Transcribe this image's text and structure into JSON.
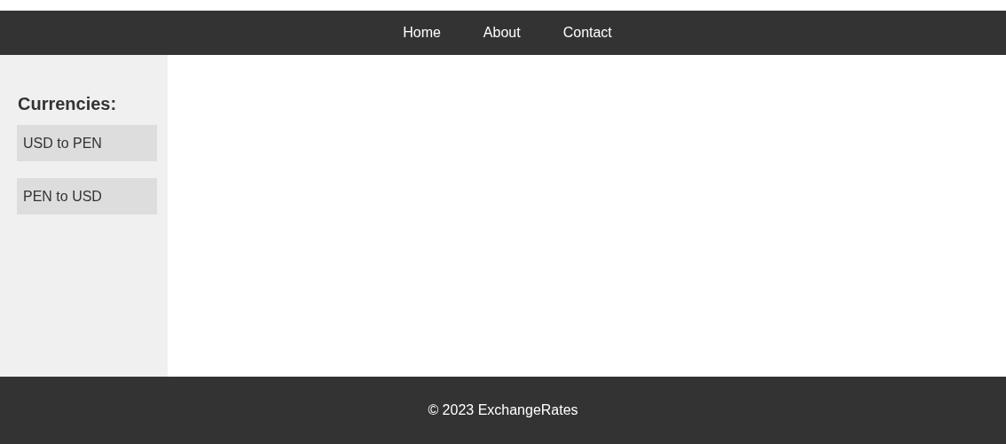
{
  "nav": {
    "links": [
      "Home",
      "About",
      "Contact"
    ]
  },
  "sidebar": {
    "title": "Currencies:",
    "items": [
      "USD to PEN",
      "PEN to USD"
    ]
  },
  "footer": {
    "text": "© 2023 ExchangeRates"
  }
}
